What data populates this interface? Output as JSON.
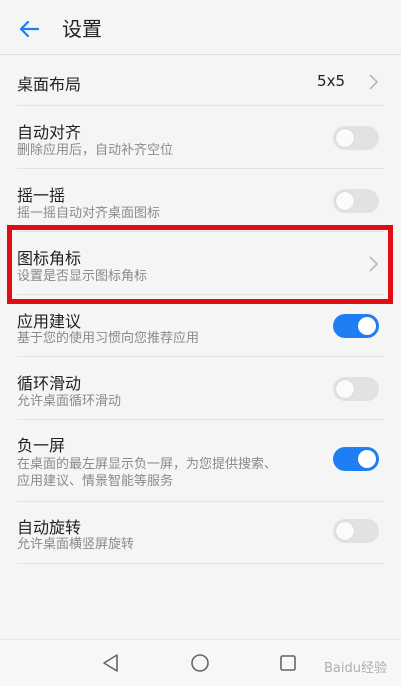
{
  "header": {
    "title": "设置",
    "back_icon": "arrow-left-icon",
    "accent": "#1e7ff4"
  },
  "rows": [
    {
      "label": "桌面布局",
      "value": "5x5",
      "control": "chevron"
    },
    {
      "label": "自动对齐",
      "sub": "删除应用后，自动补齐空位",
      "control": "toggle",
      "state": "off"
    },
    {
      "label": "摇一摇",
      "sub": "摇一摇自动对齐桌面图标",
      "control": "toggle",
      "state": "off"
    },
    {
      "label": "图标角标",
      "sub": "设置是否显示图标角标",
      "control": "chevron",
      "highlighted": true
    },
    {
      "label": "应用建议",
      "sub": "基于您的使用习惯向您推荐应用",
      "control": "toggle",
      "state": "on"
    },
    {
      "label": "循环滑动",
      "sub": "允许桌面循环滑动",
      "control": "toggle",
      "state": "off"
    },
    {
      "label": "负一屏",
      "sub_line1": "在桌面的最左屏显示负一屏，为您提供搜索、",
      "sub_line2": "应用建议、情景智能等服务",
      "control": "toggle",
      "state": "on"
    },
    {
      "label": "自动旋转",
      "sub": "允许桌面横竖屏旋转",
      "control": "toggle",
      "state": "off"
    }
  ],
  "highlight_color": "#e10c14",
  "navbar": {
    "back": "triangle-back-icon",
    "home": "circle-home-icon",
    "recent": "square-recent-icon"
  },
  "watermark": {
    "text": "Baidu经验"
  }
}
